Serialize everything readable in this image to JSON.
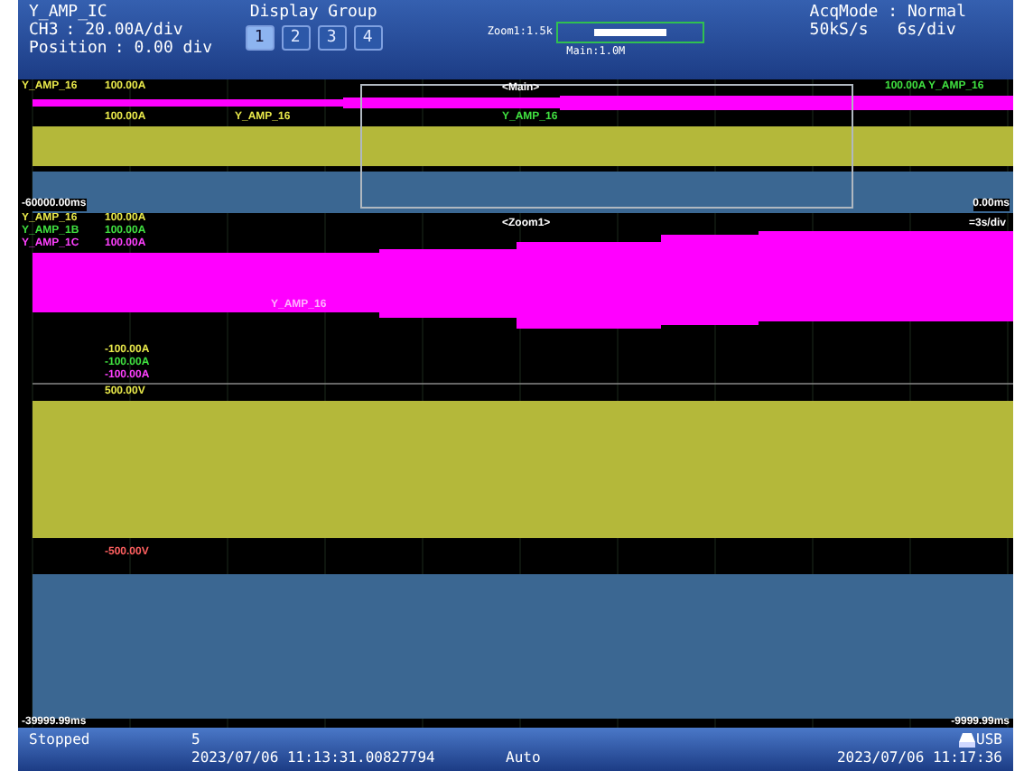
{
  "header": {
    "trace_name": "Y_AMP_IC",
    "channel": "CH3",
    "scale": ": 20.00A/div",
    "position_label": "Position",
    "position": ": 0.00 div",
    "display_group": {
      "title": "Display Group",
      "buttons": [
        {
          "label": "1",
          "selected": true
        },
        {
          "label": "2",
          "selected": false
        },
        {
          "label": "3",
          "selected": false
        },
        {
          "label": "4",
          "selected": false
        }
      ]
    },
    "zoom_bar": {
      "zoom_label": "Zoom1:1.5k",
      "main_label": "Main:1.0M",
      "level": 0.5
    },
    "acq_mode": "AcqMode : Normal",
    "sample_rate": "50kS/s",
    "time_div": "6s/div"
  },
  "main_window": {
    "title": "<Main>",
    "start_time": "-60000.00ms",
    "end_time": "0.00ms",
    "labels": [
      {
        "text": "Y_AMP_16",
        "color": "#e8e84a"
      },
      {
        "text": "100.00A",
        "color": "#e8e84a"
      },
      {
        "text": "100.00A",
        "color": "#e8e84a"
      },
      {
        "text": "Y_AMP_16",
        "color": "#e8e84a"
      },
      {
        "text": "Y_AMP_16",
        "color": "#40e040"
      },
      {
        "text": "100.00A Y_AMP_16",
        "color": "#40e040"
      }
    ]
  },
  "zoom_window": {
    "title": "<Zoom1>",
    "time_div": "=3s/div",
    "start_time": "-39999.99ms",
    "end_time": "-9999.99ms",
    "labels": [
      {
        "text": "Y_AMP_16",
        "color": "#e8e84a"
      },
      {
        "text": "Y_AMP_1B",
        "color": "#40e040"
      },
      {
        "text": "Y_AMP_1C",
        "color": "#ff40ff"
      },
      {
        "text": "100.00A",
        "color": "#e8e84a"
      },
      {
        "text": "100.00A",
        "color": "#40e040"
      },
      {
        "text": "100.00A",
        "color": "#ff40ff"
      },
      {
        "text": "Y_AMP_16",
        "color": "#ffb0ff"
      },
      {
        "text": "-100.00A",
        "color": "#e8e84a"
      },
      {
        "text": "-100.00A",
        "color": "#40e040"
      },
      {
        "text": "-100.00A",
        "color": "#ff40ff"
      },
      {
        "text": "500.00V",
        "color": "#e8e84a"
      },
      {
        "text": "-500.00V",
        "color": "#ff6060"
      }
    ]
  },
  "status_bar": {
    "state": "Stopped",
    "count": "5",
    "trigger_time": "2023/07/06 11:13:31.00827794",
    "mode": "Auto",
    "storage": "USB",
    "clock": "2023/07/06 11:17:36"
  }
}
